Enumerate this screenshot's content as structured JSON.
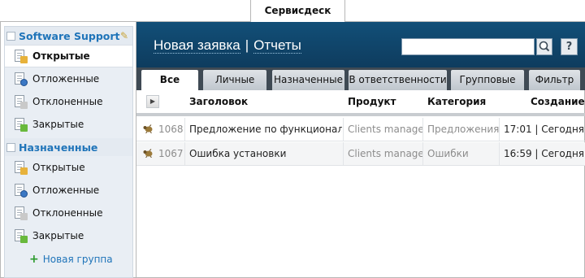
{
  "app": {
    "tab_title": "Сервисдеск"
  },
  "sidebar": {
    "group1": {
      "title": "Software Support",
      "items": [
        {
          "label": "Открытые",
          "icon": "open-ticket-icon"
        },
        {
          "label": "Отложенные",
          "icon": "paused-ticket-icon"
        },
        {
          "label": "Отклоненные",
          "icon": "declined-ticket-icon"
        },
        {
          "label": "Закрытые",
          "icon": "closed-ticket-icon"
        }
      ]
    },
    "group2": {
      "title": "Назначенные",
      "items": [
        {
          "label": "Открытые",
          "icon": "open-ticket-icon"
        },
        {
          "label": "Отложенные",
          "icon": "paused-ticket-icon"
        },
        {
          "label": "Отклоненные",
          "icon": "declined-ticket-icon"
        },
        {
          "label": "Закрытые",
          "icon": "closed-ticket-icon"
        }
      ]
    },
    "new_group": "Новая группа"
  },
  "header": {
    "new_request": "Новая заявка",
    "separator": "|",
    "reports": "Отчеты",
    "search_value": "",
    "help": "?"
  },
  "tabs": [
    {
      "label": "Все",
      "active": true
    },
    {
      "label": "Личные"
    },
    {
      "label": "Назначенные"
    },
    {
      "label": "В ответственности"
    },
    {
      "label": "Групповые"
    },
    {
      "label": "Фильтр"
    }
  ],
  "table": {
    "columns": {
      "title": "Заголовок",
      "product": "Продукт",
      "category": "Категория",
      "created": "Создание"
    },
    "rows": [
      {
        "id": "1068",
        "title": "Предложение по функционалу",
        "product": "Clients manager",
        "category": "Предложения",
        "created": "17:01 | Сегодня"
      },
      {
        "id": "1067",
        "title": "Ошибка установки",
        "product": "Clients manager",
        "category": "Ошибки",
        "created": "16:59 | Сегодня"
      }
    ]
  },
  "colors": {
    "header_bg": "#124f78",
    "link_blue": "#1f74b9",
    "tabbar_bg": "#3f4a54"
  }
}
